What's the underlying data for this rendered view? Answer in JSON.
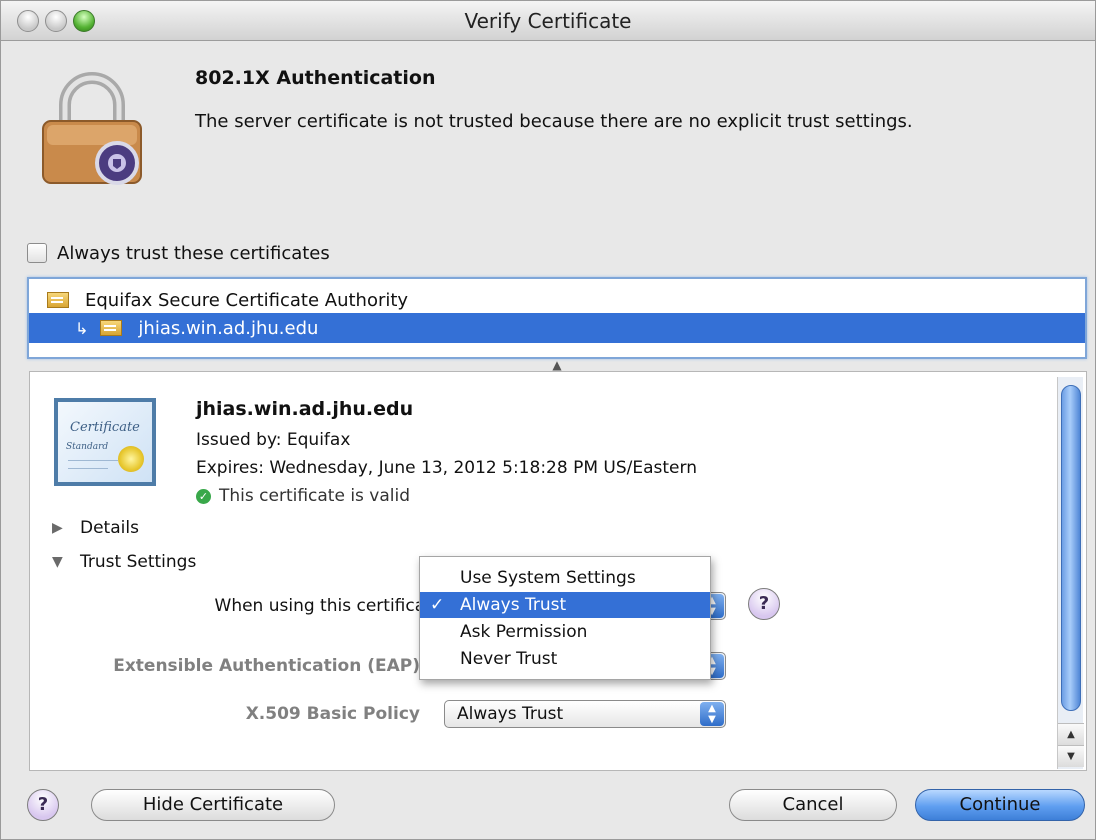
{
  "window": {
    "title": "Verify Certificate"
  },
  "header": {
    "heading": "802.1X Authentication",
    "message": "The server certificate is not trusted because there are no explicit trust settings."
  },
  "always_trust_checkbox": {
    "label": "Always trust these certificates",
    "checked": false
  },
  "certificate_list": [
    {
      "name": "Equifax Secure Certificate Authority",
      "selected": false
    },
    {
      "name": "jhias.win.ad.jhu.edu",
      "selected": true
    }
  ],
  "details": {
    "cert_image": {
      "text1": "Certificate",
      "text2": "Standard"
    },
    "name": "jhias.win.ad.jhu.edu",
    "issued_by": "Issued by: Equifax",
    "expires": "Expires: Wednesday, June 13, 2012 5:18:28 PM US/Eastern",
    "valid": "This certificate is valid",
    "details_label": "Details",
    "trust_settings_label": "Trust Settings",
    "when_using_label": "When using this certificate:",
    "eap_label": "Extensible Authentication (EAP)",
    "x509_label": "X.509 Basic Policy",
    "x509_value": "Always Trust"
  },
  "trust_menu": {
    "items": [
      "Use System Settings",
      "Always Trust",
      "Ask Permission",
      "Never Trust"
    ],
    "selected": "Always Trust",
    "check": "✓"
  },
  "buttons": {
    "help": "?",
    "hide_certificate": "Hide Certificate",
    "cancel": "Cancel",
    "continue": "Continue"
  },
  "colors": {
    "selection": "#3470d6",
    "default_button": "#5f9ef0",
    "valid_green": "#39a84a"
  }
}
